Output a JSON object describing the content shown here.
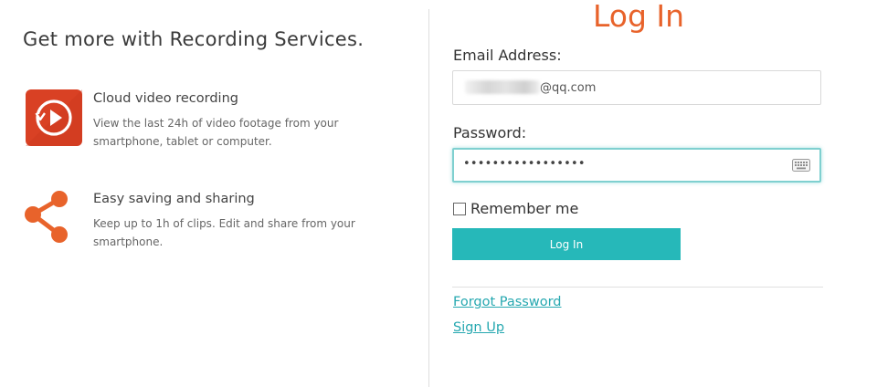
{
  "promo": {
    "title": "Get more with Recording Services.",
    "features": [
      {
        "icon": "cloud-video-recording-icon",
        "title": "Cloud video recording",
        "description_lines": [
          "View the last 24h of video footage from your",
          "smartphone, tablet or computer."
        ]
      },
      {
        "icon": "share-icon",
        "title": "Easy saving and sharing",
        "description_lines": [
          "Keep up to 1h of clips. Edit and share from your",
          "smartphone."
        ]
      }
    ]
  },
  "login": {
    "heading": "Log In",
    "email_label": "Email Address:",
    "email_value_visible": "@qq.com",
    "password_label": "Password:",
    "password_masked": "•••••••••••••••••",
    "remember_label": "Remember me",
    "remember_checked": false,
    "submit_label": "Log In",
    "forgot_password": "Forgot Password",
    "sign_up": "Sign Up"
  },
  "colors": {
    "accent_orange": "#e8632b",
    "teal_button": "#26b8b9",
    "teal_link": "#26a8b0",
    "focus_border": "#7fd0d0"
  }
}
